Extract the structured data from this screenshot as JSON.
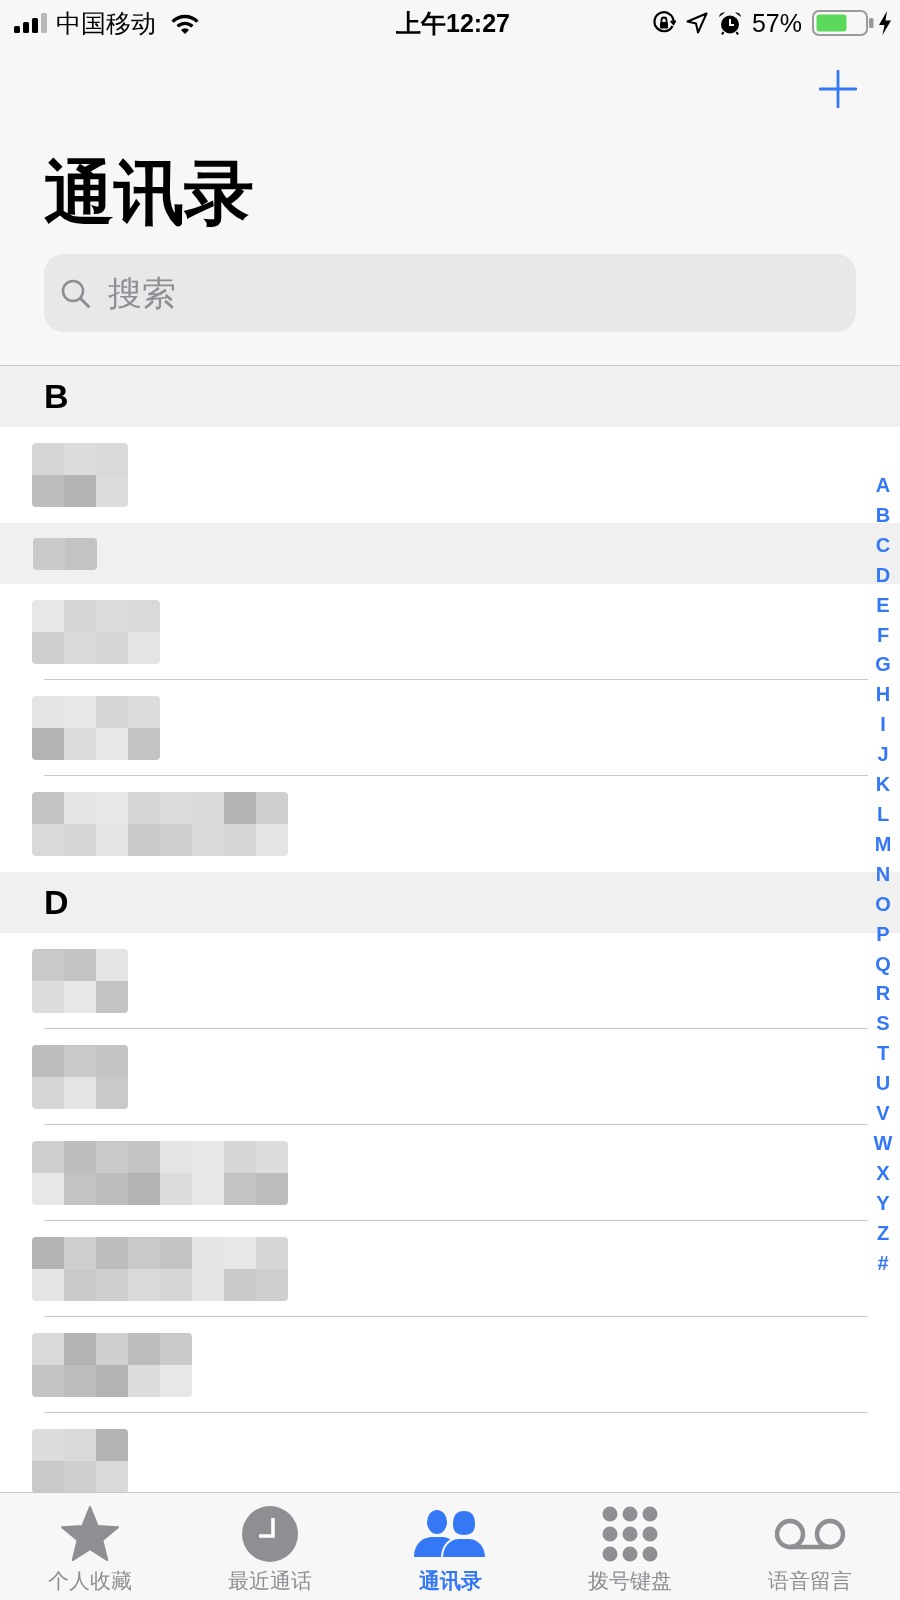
{
  "status_bar": {
    "carrier": "中国移动",
    "time": "上午12:27",
    "battery": "57%"
  },
  "title": "通讯录",
  "search": {
    "placeholder": "搜索"
  },
  "sections": [
    {
      "kind": "letter",
      "letter": "B",
      "contacts": [
        {
          "kind": "short"
        }
      ]
    },
    {
      "kind": "pixelated",
      "contacts": [
        {
          "kind": "medium"
        },
        {
          "kind": "medium"
        },
        {
          "kind": "long"
        }
      ]
    },
    {
      "kind": "letter",
      "letter": "D",
      "contacts": [
        {
          "kind": "short"
        },
        {
          "kind": "short"
        },
        {
          "kind": "long"
        },
        {
          "kind": "long"
        },
        {
          "kind": "wide"
        },
        {
          "kind": "short"
        }
      ]
    }
  ],
  "index": [
    "A",
    "B",
    "C",
    "D",
    "E",
    "F",
    "G",
    "H",
    "I",
    "J",
    "K",
    "L",
    "M",
    "N",
    "O",
    "P",
    "Q",
    "R",
    "S",
    "T",
    "U",
    "V",
    "W",
    "X",
    "Y",
    "Z",
    "#"
  ],
  "tab_bar": [
    {
      "label": "个人收藏",
      "selected": false
    },
    {
      "label": "最近通话",
      "selected": false
    },
    {
      "label": "通讯录",
      "selected": true
    },
    {
      "label": "拨号键盘",
      "selected": false
    },
    {
      "label": "语音留言",
      "selected": false
    }
  ]
}
